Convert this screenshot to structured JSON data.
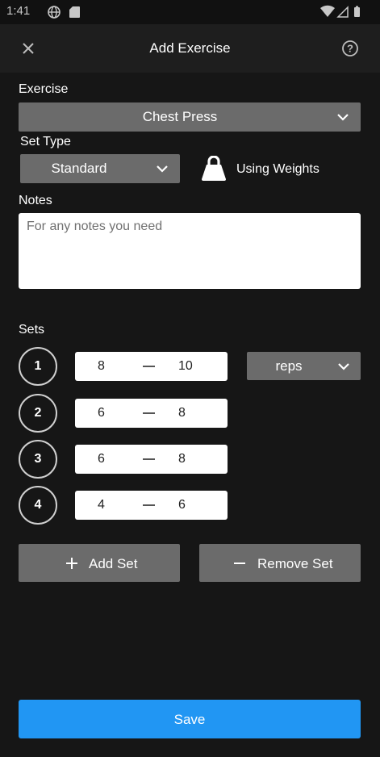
{
  "status_bar": {
    "time": "1:41",
    "icons": [
      "globe-icon",
      "sim-card-icon",
      "wifi-icon",
      "signal-icon",
      "battery-icon"
    ]
  },
  "app_bar": {
    "title": "Add Exercise",
    "left_icon": "close-icon",
    "right_icon": "help-icon"
  },
  "form": {
    "exercise_label": "Exercise",
    "exercise_value": "Chest Press",
    "set_type_label": "Set Type",
    "set_type_value": "Standard",
    "weights_icon": "kettlebell-icon",
    "weights_label": "Using Weights",
    "notes_label": "Notes",
    "notes_placeholder": "For any notes you need",
    "notes_value": ""
  },
  "sets": {
    "label": "Sets",
    "unit": "reps",
    "rows": [
      {
        "number": "1",
        "min": "8",
        "max": "10"
      },
      {
        "number": "2",
        "min": "6",
        "max": "8"
      },
      {
        "number": "3",
        "min": "6",
        "max": "8"
      },
      {
        "number": "4",
        "min": "4",
        "max": "6"
      }
    ]
  },
  "actions": {
    "add_set": "Add Set",
    "remove_set": "Remove Set",
    "save": "Save"
  },
  "colors": {
    "background": "#161616",
    "app_bar": "#1e1e1e",
    "control_grey": "#6b6b6b",
    "accent": "#2196f3"
  }
}
